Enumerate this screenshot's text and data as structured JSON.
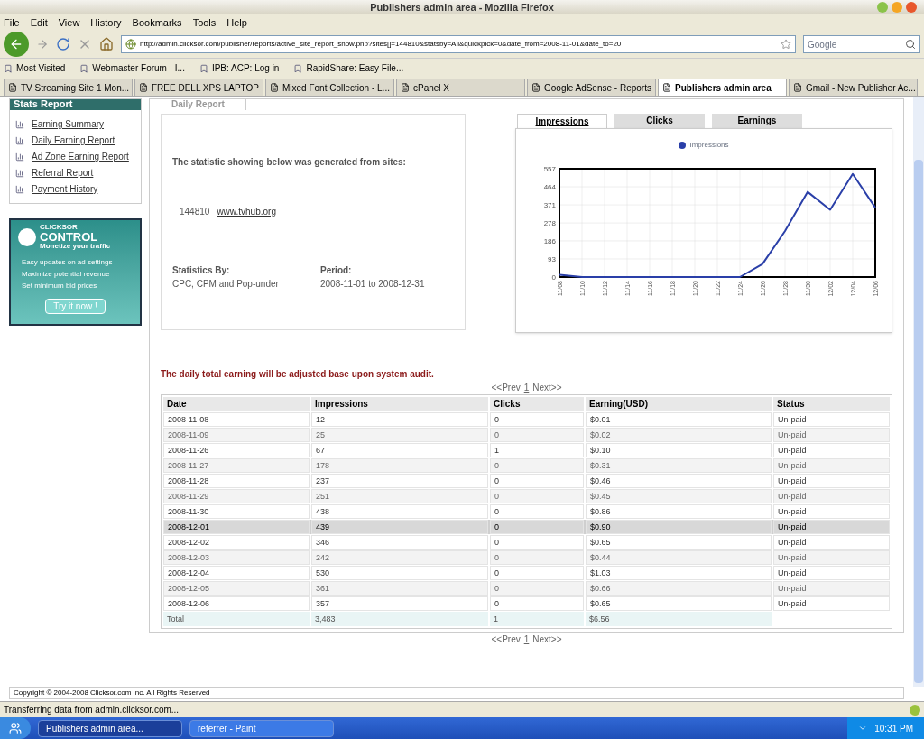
{
  "window": {
    "title": "Publishers admin area - Mozilla Firefox"
  },
  "menu": [
    "File",
    "Edit",
    "View",
    "History",
    "Bookmarks",
    "Tools",
    "Help"
  ],
  "address": {
    "value": "http://admin.clicksor.com/publisher/reports/active_site_report_show.php?sites[]=144810&statsby=All&quickpick=0&date_from=2008-11-01&date_to=20"
  },
  "search": {
    "placeholder": "Google"
  },
  "bookmarks": [
    "Most Visited",
    "Webmaster Forum - I...",
    "IPB: ACP: Log in",
    "RapidShare: Easy File..."
  ],
  "tabs": [
    {
      "label": "TV Streaming Site 1 Mon...",
      "selected": false
    },
    {
      "label": "FREE DELL XPS LAPTOP",
      "selected": false
    },
    {
      "label": "Mixed Font Collection - L...",
      "selected": false
    },
    {
      "label": "cPanel X",
      "selected": false
    },
    {
      "label": "Google AdSense - Reports",
      "selected": false
    },
    {
      "label": "Publishers admin area",
      "selected": true
    },
    {
      "label": "Gmail - New Publisher Ac...",
      "selected": false
    }
  ],
  "sidebar": {
    "title": "Stats Report",
    "items": [
      "Earning Summary",
      "Daily Earning Report",
      "Ad Zone Earning Report",
      "Referral Report",
      "Payment History"
    ]
  },
  "promo": {
    "brand_small": "CLICKSOR",
    "brand": "CONTROL",
    "tagline": "Monetize your traffic",
    "features": [
      "Easy updates on ad settings",
      "Maximize potential revenue",
      "Set minimum bid prices"
    ],
    "button": "Try it now !"
  },
  "report_tab": "Daily Report",
  "summary": {
    "heading": "The statistic showing below was generated from sites:",
    "site_id": "144810",
    "site_link": "www.tvhub.org",
    "stats_by_label": "Statistics By:",
    "stats_by": "CPC, CPM and Pop-under",
    "period_label": "Period:",
    "period": "2008-11-01 to 2008-12-31"
  },
  "chart_tabs": [
    {
      "label": "Impressions",
      "selected": true
    },
    {
      "label": "Clicks",
      "selected": false
    },
    {
      "label": "Earnings",
      "selected": false
    }
  ],
  "chart_data": {
    "type": "line",
    "grid": true,
    "categories": [
      "11/08",
      "11/10",
      "11/12",
      "11/14",
      "11/16",
      "11/18",
      "11/20",
      "11/22",
      "11/24",
      "11/26",
      "11/28",
      "11/30",
      "12/02",
      "12/04",
      "12/06"
    ],
    "series": [
      {
        "name": "Impressions",
        "color": "#2a3fa8",
        "values": [
          12,
          0,
          0,
          0,
          0,
          0,
          0,
          0,
          0,
          67,
          237,
          438,
          346,
          530,
          357
        ]
      }
    ],
    "ylim": [
      0,
      557
    ],
    "yticks": [
      0,
      93,
      186,
      278,
      371,
      464,
      557
    ]
  },
  "notice": "The daily total earning will be adjusted base upon system audit.",
  "pagination": [
    {
      "prev": "<<Prev",
      "page": "1",
      "next": "Next>>"
    },
    {
      "prev": "<<Prev",
      "page": "1",
      "next": "Next>>"
    }
  ],
  "table": {
    "columns": [
      "Date",
      "Impressions",
      "Clicks",
      "Earning(USD)",
      "Status"
    ],
    "rows": [
      {
        "cells": [
          "2008-11-08",
          "12",
          "0",
          "$0.01",
          "Un-paid"
        ],
        "highlighted": false
      },
      {
        "cells": [
          "2008-11-09",
          "25",
          "0",
          "$0.02",
          "Un-paid"
        ],
        "highlighted": false
      },
      {
        "cells": [
          "2008-11-26",
          "67",
          "1",
          "$0.10",
          "Un-paid"
        ],
        "highlighted": false
      },
      {
        "cells": [
          "2008-11-27",
          "178",
          "0",
          "$0.31",
          "Un-paid"
        ],
        "highlighted": false
      },
      {
        "cells": [
          "2008-11-28",
          "237",
          "0",
          "$0.46",
          "Un-paid"
        ],
        "highlighted": false
      },
      {
        "cells": [
          "2008-11-29",
          "251",
          "0",
          "$0.45",
          "Un-paid"
        ],
        "highlighted": false
      },
      {
        "cells": [
          "2008-11-30",
          "438",
          "0",
          "$0.86",
          "Un-paid"
        ],
        "highlighted": false
      },
      {
        "cells": [
          "2008-12-01",
          "439",
          "0",
          "$0.90",
          "Un-paid"
        ],
        "highlighted": true
      },
      {
        "cells": [
          "2008-12-02",
          "346",
          "0",
          "$0.65",
          "Un-paid"
        ],
        "highlighted": false
      },
      {
        "cells": [
          "2008-12-03",
          "242",
          "0",
          "$0.44",
          "Un-paid"
        ],
        "highlighted": false
      },
      {
        "cells": [
          "2008-12-04",
          "530",
          "0",
          "$1.03",
          "Un-paid"
        ],
        "highlighted": false
      },
      {
        "cells": [
          "2008-12-05",
          "361",
          "0",
          "$0.66",
          "Un-paid"
        ],
        "highlighted": false
      },
      {
        "cells": [
          "2008-12-06",
          "357",
          "0",
          "$0.65",
          "Un-paid"
        ],
        "highlighted": false
      }
    ],
    "total": [
      "Total",
      "3,483",
      "1",
      "$6.56"
    ]
  },
  "footer": "Copyright © 2004-2008 Clicksor.com Inc. All Rights Reserved",
  "status_bar": "Transferring data from admin.clicksor.com...",
  "taskbar": {
    "items": [
      {
        "label": "Publishers admin area...",
        "selected": true
      },
      {
        "label": "referrer - Paint",
        "selected": false
      }
    ],
    "clock": "10:31 PM"
  }
}
